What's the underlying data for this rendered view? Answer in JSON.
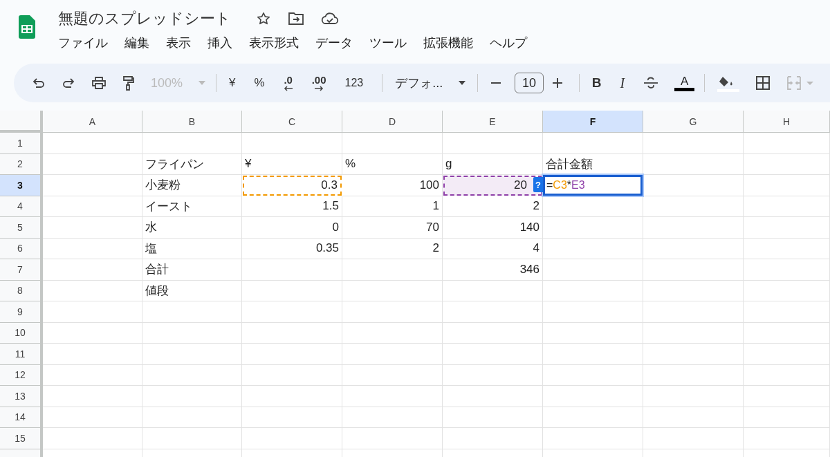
{
  "document": {
    "title": "無題のスプレッドシート"
  },
  "menu": [
    "ファイル",
    "編集",
    "表示",
    "挿入",
    "表示形式",
    "データ",
    "ツール",
    "拡張機能",
    "ヘルプ"
  ],
  "toolbar": {
    "zoom": {
      "text": "100%",
      "disabled": true
    },
    "number_formats": [
      "¥",
      "%"
    ],
    "decrease_decimals": ".0",
    "increase_decimals": ".00",
    "more_formats": "123",
    "font": "デフォ...",
    "font_size": "10",
    "bold": "B",
    "italic": "I",
    "text_color": "A",
    "merge": {
      "disabled": true
    }
  },
  "columns": [
    {
      "label": "A",
      "selected": false
    },
    {
      "label": "B",
      "selected": false
    },
    {
      "label": "C",
      "selected": false
    },
    {
      "label": "D",
      "selected": false
    },
    {
      "label": "E",
      "selected": false
    },
    {
      "label": "F",
      "selected": true
    },
    {
      "label": "G",
      "selected": false
    },
    {
      "label": "H",
      "selected": false
    }
  ],
  "rows": [
    {
      "label": "1",
      "selected": false,
      "cells": [
        null,
        null,
        null,
        null,
        null,
        null,
        null,
        null
      ]
    },
    {
      "label": "2",
      "selected": false,
      "cells": [
        null,
        {
          "kind": "text",
          "text": "フライパン"
        },
        {
          "kind": "text",
          "text": "¥"
        },
        {
          "kind": "text",
          "text": "%"
        },
        {
          "kind": "text",
          "text": "g"
        },
        {
          "kind": "text",
          "text": "合計金額"
        },
        null,
        null
      ]
    },
    {
      "label": "3",
      "selected": true,
      "cells": [
        null,
        {
          "kind": "text",
          "text": "小麦粉"
        },
        {
          "kind": "number",
          "text": "0.3",
          "color": "#f29900"
        },
        {
          "kind": "number",
          "text": "100"
        },
        {
          "kind": "number",
          "text": "20",
          "color": "#8e3fa8"
        },
        {
          "kind": "formula",
          "hint": "?",
          "parts": [
            {
              "text": "="
            },
            {
              "text": "C3",
              "color": "#f29900"
            },
            {
              "text": "*"
            },
            {
              "text": "E3",
              "color": "#8e3fa8"
            }
          ]
        },
        null,
        null
      ]
    },
    {
      "label": "4",
      "selected": false,
      "cells": [
        null,
        {
          "kind": "text",
          "text": "イースト"
        },
        {
          "kind": "number",
          "text": "1.5"
        },
        {
          "kind": "number",
          "text": "1"
        },
        {
          "kind": "number",
          "text": "2"
        },
        null,
        null,
        null
      ]
    },
    {
      "label": "5",
      "selected": false,
      "cells": [
        null,
        {
          "kind": "text",
          "text": "水"
        },
        {
          "kind": "number",
          "text": "0"
        },
        {
          "kind": "number",
          "text": "70"
        },
        {
          "kind": "number",
          "text": "140"
        },
        null,
        null,
        null
      ]
    },
    {
      "label": "6",
      "selected": false,
      "cells": [
        null,
        {
          "kind": "text",
          "text": "塩"
        },
        {
          "kind": "number",
          "text": "0.35"
        },
        {
          "kind": "number",
          "text": "2"
        },
        {
          "kind": "number",
          "text": "4"
        },
        null,
        null,
        null
      ]
    },
    {
      "label": "7",
      "selected": false,
      "cells": [
        null,
        {
          "kind": "text",
          "text": "合計"
        },
        null,
        null,
        {
          "kind": "number",
          "text": "346"
        },
        null,
        null,
        null
      ]
    },
    {
      "label": "8",
      "selected": false,
      "cells": [
        null,
        {
          "kind": "text",
          "text": "値段"
        },
        null,
        null,
        null,
        null,
        null,
        null
      ]
    },
    {
      "label": "9",
      "selected": false,
      "cells": [
        null,
        null,
        null,
        null,
        null,
        null,
        null,
        null
      ]
    },
    {
      "label": "10",
      "selected": false,
      "cells": [
        null,
        null,
        null,
        null,
        null,
        null,
        null,
        null
      ]
    },
    {
      "label": "11",
      "selected": false,
      "cells": [
        null,
        null,
        null,
        null,
        null,
        null,
        null,
        null
      ]
    },
    {
      "label": "12",
      "selected": false,
      "cells": [
        null,
        null,
        null,
        null,
        null,
        null,
        null,
        null
      ]
    },
    {
      "label": "13",
      "selected": false,
      "cells": [
        null,
        null,
        null,
        null,
        null,
        null,
        null,
        null
      ]
    },
    {
      "label": "14",
      "selected": false,
      "cells": [
        null,
        null,
        null,
        null,
        null,
        null,
        null,
        null
      ]
    },
    {
      "label": "15",
      "selected": false,
      "cells": [
        null,
        null,
        null,
        null,
        null,
        null,
        null,
        null
      ]
    }
  ]
}
